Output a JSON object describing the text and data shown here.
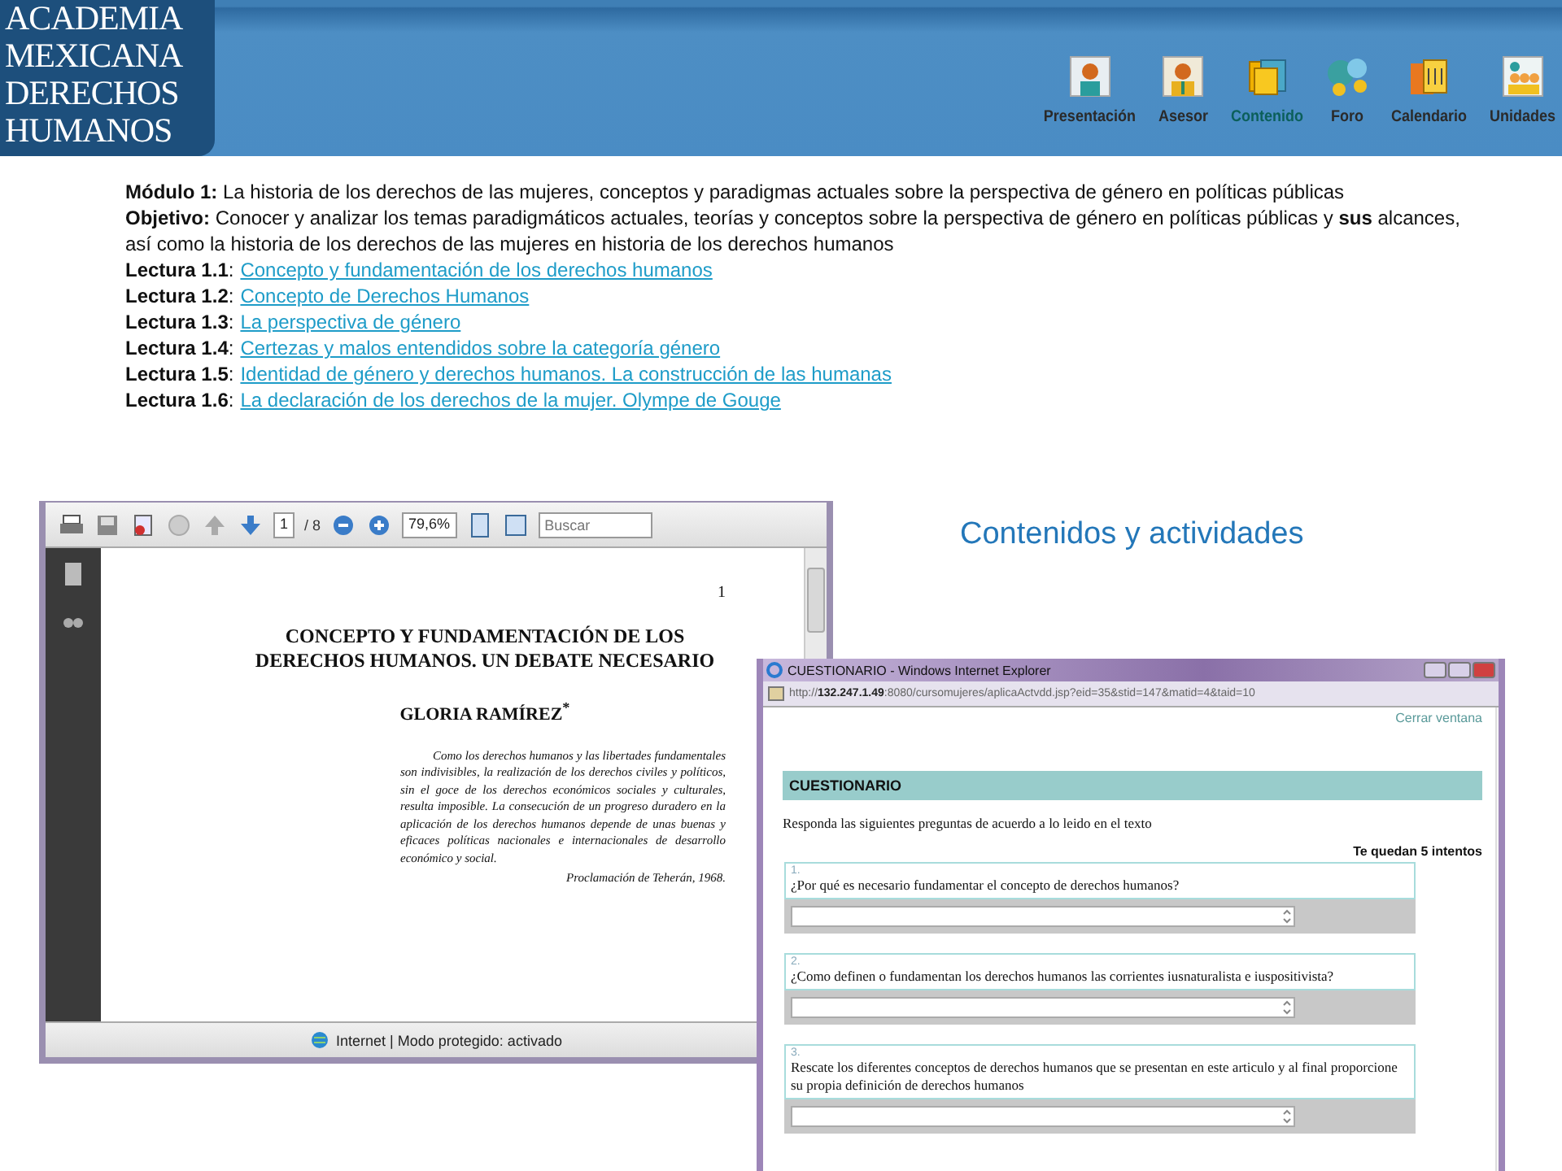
{
  "header": {
    "logo_lines": [
      "ACADEMIA",
      "MEXICANA",
      "DERECHOS",
      "HUMANOS"
    ],
    "nav": [
      {
        "label": "Presentación",
        "kind": "person",
        "selected": false
      },
      {
        "label": "Asesor",
        "kind": "advisor",
        "selected": false
      },
      {
        "label": "Contenido",
        "kind": "folders",
        "selected": true
      },
      {
        "label": "Foro",
        "kind": "chat",
        "selected": false
      },
      {
        "label": "Calendario",
        "kind": "calendar",
        "selected": false
      },
      {
        "label": "Unidades",
        "kind": "group",
        "selected": false
      }
    ]
  },
  "module": "**Módulo  1:** La historia de los derechos de las mujeres,  conceptos y paradigmas actuales sobre la perspectiva de género en políticas públicas",
  "objective": "**Objetivo:** Conocer y analizar  los temas paradigmáticos actuales, teorías y conceptos sobre la perspectiva de género en políticas públicas y **sus** alcances, así como la historia de los derechos de las mujeres  en historia de los derechos humanos",
  "readings": [
    {
      "label": "**Lectura  1.1**:",
      "title": "Concepto y fundamentación de los derechos humanos"
    },
    {
      "label": "**Lectura  1.2**:",
      "title": "Concepto de Derechos Humanos"
    },
    {
      "label": "**Lectura  1.3**:",
      "title": "La perspectiva de género"
    },
    {
      "label": "**Lectura  1.4**:",
      "title": "Certezas  y malos entendidos sobre la categoría género"
    },
    {
      "label": "**Lectura  1.5**:",
      "title": "Identidad de género y derechos humanos. La  construcción de las humanas"
    },
    {
      "label": "**Lectura  1.6**:",
      "title": "La declaración de los derechos de la mujer.  Olympe de Gouge"
    }
  ],
  "pdf_viewer": {
    "page_current": "1",
    "page_total": "/ 8",
    "zoom": "79,6%",
    "search_placeholder": "Buscar",
    "page_number": "1",
    "title_lines": [
      "CONCEPTO Y FUNDAMENTACIÓN DE LOS",
      "DERECHOS HUMANOS. UN DEBATE NECESARIO"
    ],
    "author": "GLORIA RAMÍREZ$^{*}$",
    "quote": "Como los derechos humanos y las libertades fundamentales son indivisibles, la realización de los derechos civiles y políticos, sin el goce de los derechos económicos sociales y culturales, resulta imposible. La consecución de un progreso duradero en la aplicación de los derechos humanos depende de unas buenas y eficaces políticas nacionales e internacionales de desarrollo económico y social.",
    "quote_source": "Proclamación de Teherán, 1968.",
    "status": "Internet | Modo protegido: activado"
  },
  "section_title": "Contenidos y actividades",
  "quiz_window": {
    "title": "CUESTIONARIO - Windows Internet Explorer",
    "url": "http://**132.247.1.49**:8080/cursomujeres/aplicaActvdd.jsp?eid=35&stid=147&matid=4&taid=10",
    "close_link": "Cerrar ventana",
    "heading": "CUESTIONARIO",
    "instructions": "Responda las siguientes preguntas de acuerdo a lo leido en el texto",
    "attempts": "Te quedan 5 intentos",
    "questions": [
      {
        "number": "1.",
        "text": "¿Por qué es necesario fundamentar el concepto de  derechos humanos?"
      },
      {
        "number": "2.",
        "text": "¿Como definen o fundamentan los derechos humanos las corrientes iusnaturalista e iuspositivista?"
      },
      {
        "number": "3.",
        "text": "Rescate los diferentes conceptos de derechos humanos que se presentan en este articulo y al final proporcione su propia definición de derechos humanos"
      }
    ]
  }
}
